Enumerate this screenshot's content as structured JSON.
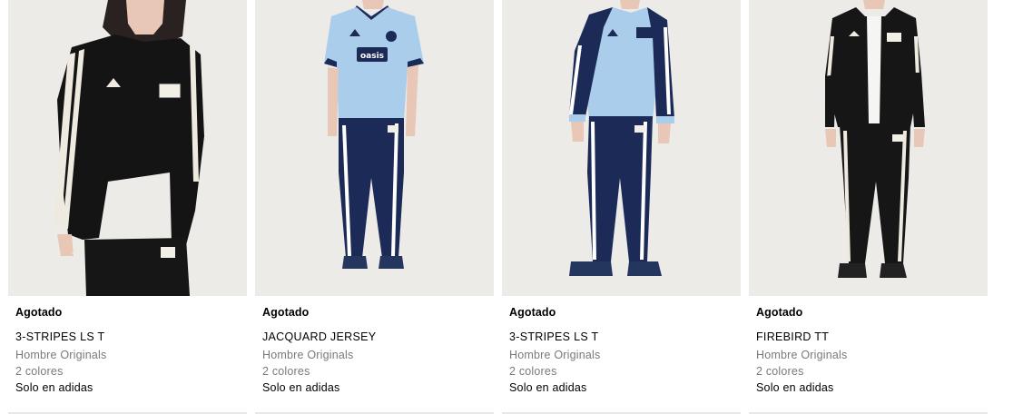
{
  "products": [
    {
      "status": "Agotado",
      "name": "3-STRIPES LS T",
      "category": "Hombre Originals",
      "colors": "2 colores",
      "exclusive": "Solo en adidas",
      "image_icon": "black-longsleeve-tee-model-image",
      "garment_colors": {
        "top": "#141414",
        "bottom": "#141414",
        "stripes": "#eeeadf",
        "bg": "#ecebe8"
      }
    },
    {
      "status": "Agotado",
      "name": "JACQUARD JERSEY",
      "category": "Hombre Originals",
      "colors": "2 colores",
      "exclusive": "Solo en adidas",
      "image_icon": "light-blue-jersey-model-image",
      "garment_colors": {
        "top": "#a9cdea",
        "bottom": "#1c2a57",
        "stripes": "#ffffff",
        "bg": "#ecebe8"
      }
    },
    {
      "status": "Agotado",
      "name": "3-STRIPES LS T",
      "category": "Hombre Originals",
      "colors": "2 colores",
      "exclusive": "Solo en adidas",
      "image_icon": "blue-longsleeve-tee-model-image",
      "garment_colors": {
        "top": "#a9cdea",
        "bottom": "#1c2a57",
        "stripes": "#ffffff",
        "bg": "#ecebe8"
      }
    },
    {
      "status": "Agotado",
      "name": "FIREBIRD TT",
      "category": "Hombre Originals",
      "colors": "2 colores",
      "exclusive": "Solo en adidas",
      "image_icon": "black-track-jacket-model-image",
      "garment_colors": {
        "top": "#161616",
        "bottom": "#161616",
        "stripes": "#eeeadf",
        "bg": "#ecebe8"
      }
    }
  ]
}
